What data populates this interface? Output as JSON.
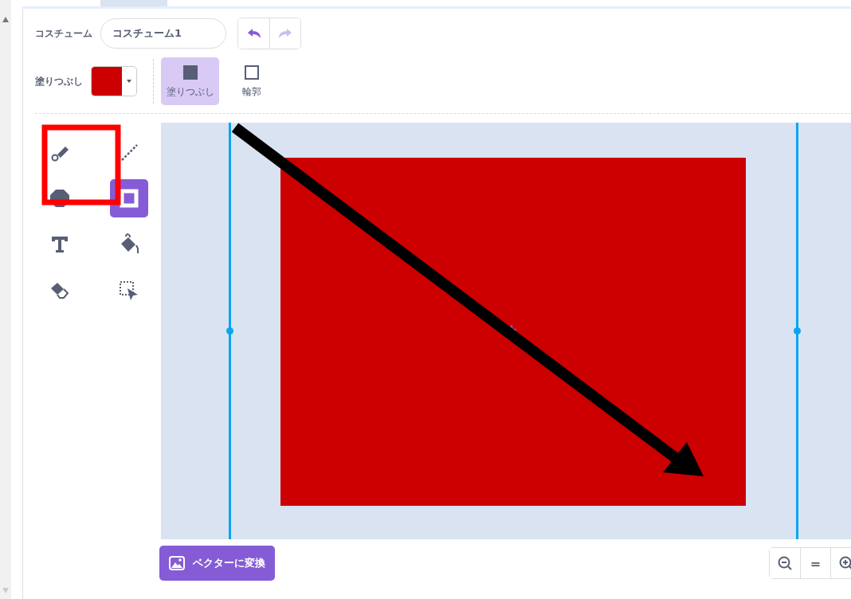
{
  "costume": {
    "label": "コスチューム",
    "name": "コスチューム1"
  },
  "history": [
    {
      "kind": "undo",
      "disabled": false
    },
    {
      "kind": "redo",
      "disabled": true
    }
  ],
  "fill": {
    "label": "塗りつぶし",
    "color": "#cc0000"
  },
  "modes": [
    {
      "kind": "filled",
      "label": "塗りつぶし",
      "selected": true
    },
    {
      "kind": "outlined",
      "label": "輪郭",
      "selected": false
    }
  ],
  "tools": [
    {
      "kind": "brush",
      "selected": false
    },
    {
      "kind": "line",
      "selected": false
    },
    {
      "kind": "circle",
      "selected": false
    },
    {
      "kind": "rectangle",
      "selected": true
    },
    {
      "kind": "text",
      "selected": false
    },
    {
      "kind": "fill",
      "selected": false
    },
    {
      "kind": "eraser",
      "selected": false
    },
    {
      "kind": "select",
      "selected": false
    }
  ],
  "convert_button": "ベクターに変換",
  "zoom": [
    {
      "kind": "zoom-out"
    },
    {
      "kind": "reset",
      "label": "="
    },
    {
      "kind": "zoom-in"
    }
  ]
}
